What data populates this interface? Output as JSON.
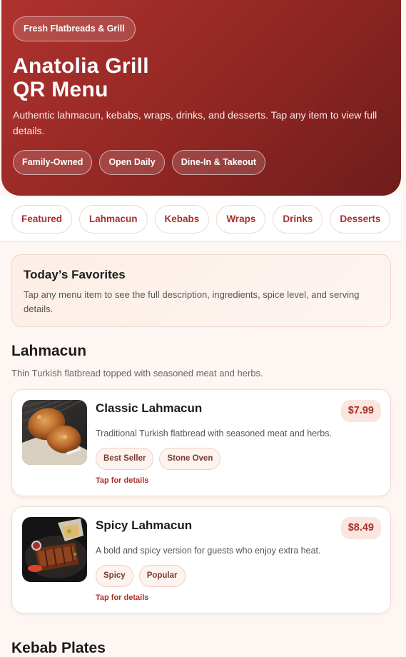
{
  "hero": {
    "tagline": "Fresh Flatbreads & Grill",
    "title_line1": "Anatolia Grill",
    "title_line2": "QR Menu",
    "description": "Authentic lahmacun, kebabs, wraps, drinks, and desserts. Tap any item to view full details.",
    "badges": [
      "Family-Owned",
      "Open Daily",
      "Dine-In & Takeout"
    ]
  },
  "tabs": [
    "Featured",
    "Lahmacun",
    "Kebabs",
    "Wraps",
    "Drinks",
    "Desserts"
  ],
  "favorites": {
    "title": "Today’s Favorites",
    "text": "Tap any menu item to see the full description, ingredients, spice level, and serving details."
  },
  "sections": [
    {
      "title": "Lahmacun",
      "subtitle": "Thin Turkish flatbread topped with seasoned meat and herbs.",
      "items": [
        {
          "name": "Classic Lahmacun",
          "price": "$7.99",
          "description": "Traditional Turkish flatbread with seasoned meat and herbs.",
          "tags": [
            "Best Seller",
            "Stone Oven"
          ],
          "cta": "Tap for details",
          "image_icon": "fried-chicken-photo"
        },
        {
          "name": "Spicy Lahmacun",
          "price": "$8.49",
          "description": "A bold and spicy version for guests who enjoy extra heat.",
          "tags": [
            "Spicy",
            "Popular"
          ],
          "cta": "Tap for details",
          "image_icon": "ribs-platter-photo"
        }
      ]
    },
    {
      "title": "Kebab Plates"
    }
  ],
  "colors": {
    "brand": "#a8302b",
    "hero_dark": "#6e1d1c",
    "background": "#fdf6f2",
    "price_bg": "#fbe6df"
  }
}
